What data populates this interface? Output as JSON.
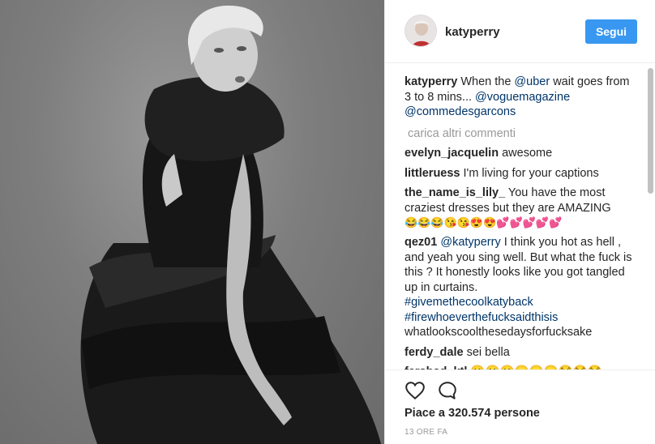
{
  "post": {
    "username": "katyperry",
    "follow_label": "Segui"
  },
  "caption": {
    "user": "katyperry",
    "text_1": " When the ",
    "mention_1": "@uber",
    "text_2": " wait goes from 3 to 8 mins... ",
    "mention_2": "@voguemagazine",
    "mention_3": "@commedesgarcons"
  },
  "load_more_label": "carica altri commenti",
  "comments": [
    {
      "user": "evelyn_jacquelin",
      "text": " awesome"
    },
    {
      "user": "littleruess",
      "text": " I'm living for your captions"
    },
    {
      "user": "the_name_is_lily_",
      "text": " You have the most craziest dresses but they are AMAZING",
      "emojis": "😂😂😂😘😘😍😍💕💕💕💕💕"
    },
    {
      "user": "qez01",
      "mention": "@katyperry",
      "text": " I think you hot as hell , and yeah you sing well. But what the fuck is this ? It honestly looks like you got tangled up in curtains. ",
      "hashtag_1": "#givemethecoolkatyback",
      "hashtag_2": "#firewhoeverthefucksaidthisis",
      "tail": "whatlookscoolthesedaysforfucksake"
    },
    {
      "user": "ferdy_dale",
      "text": " sei bella"
    },
    {
      "user": "farshad_ktl",
      "text": " ",
      "emojis": "😮😮😮😑😑😑😂😂😂"
    }
  ],
  "likes_label": "Piace a 320.574 persone",
  "timestamp": "13 ORE FA",
  "icons": {
    "like": "heart-icon",
    "comment": "comment-icon"
  },
  "colors": {
    "follow_button": "#3897f0",
    "link": "#003569",
    "muted": "#999999"
  }
}
